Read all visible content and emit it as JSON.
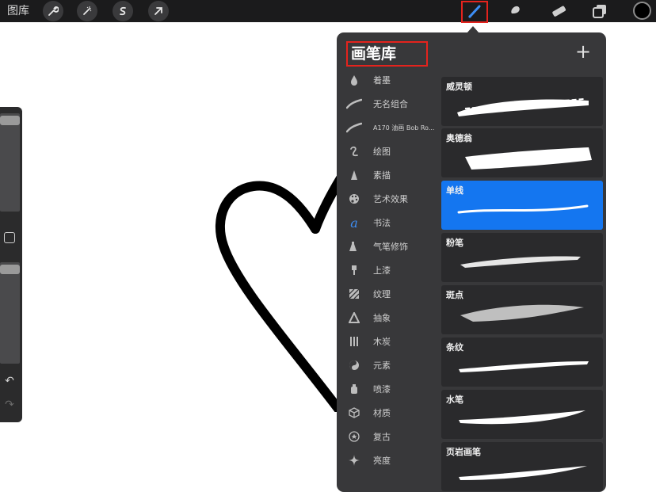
{
  "topbar": {
    "gallery_label": "图库",
    "left_tools": [
      "wrench-icon",
      "magic-wand-icon",
      "selection-icon",
      "transform-arrow-icon"
    ],
    "right_tools": [
      "brush-icon",
      "smudge-icon",
      "eraser-icon",
      "layers-icon"
    ],
    "current_color": "#000000",
    "highlight_color": "#e4231d"
  },
  "sidebar": {
    "buttons": [
      "modifier-square-icon",
      "undo-icon",
      "redo-icon"
    ]
  },
  "brush_library": {
    "title": "画笔库",
    "add_label": "+",
    "sets": [
      {
        "label": "着墨",
        "icon": "ink-drop-icon"
      },
      {
        "label": "无名组合",
        "icon": "stroke-icon"
      },
      {
        "label": "A170 油画 Bob Ro...",
        "icon": "stroke-icon"
      },
      {
        "label": "绘图",
        "icon": "squiggle-icon"
      },
      {
        "label": "素描",
        "icon": "pencil-tip-icon"
      },
      {
        "label": "艺术效果",
        "icon": "palette-icon"
      },
      {
        "label": "书法",
        "icon": "calligraphy-a-icon"
      },
      {
        "label": "气笔修饰",
        "icon": "airbrush-icon"
      },
      {
        "label": "上漆",
        "icon": "paint-brush-icon"
      },
      {
        "label": "纹理",
        "icon": "texture-icon"
      },
      {
        "label": "抽象",
        "icon": "triangle-icon"
      },
      {
        "label": "木炭",
        "icon": "charcoal-icon"
      },
      {
        "label": "元素",
        "icon": "yin-yang-icon"
      },
      {
        "label": "喷漆",
        "icon": "spray-can-icon"
      },
      {
        "label": "材质",
        "icon": "cube-icon"
      },
      {
        "label": "复古",
        "icon": "star-badge-icon"
      },
      {
        "label": "亮度",
        "icon": "sparkle-icon"
      }
    ],
    "brushes": [
      {
        "name": "威灵顿",
        "selected": false
      },
      {
        "name": "奥德翁",
        "selected": false
      },
      {
        "name": "单线",
        "selected": true
      },
      {
        "name": "粉笔",
        "selected": false
      },
      {
        "name": "斑点",
        "selected": false
      },
      {
        "name": "条纹",
        "selected": false
      },
      {
        "name": "水笔",
        "selected": false
      },
      {
        "name": "页岩画笔",
        "selected": false
      }
    ],
    "selected_color": "#1476f0"
  }
}
